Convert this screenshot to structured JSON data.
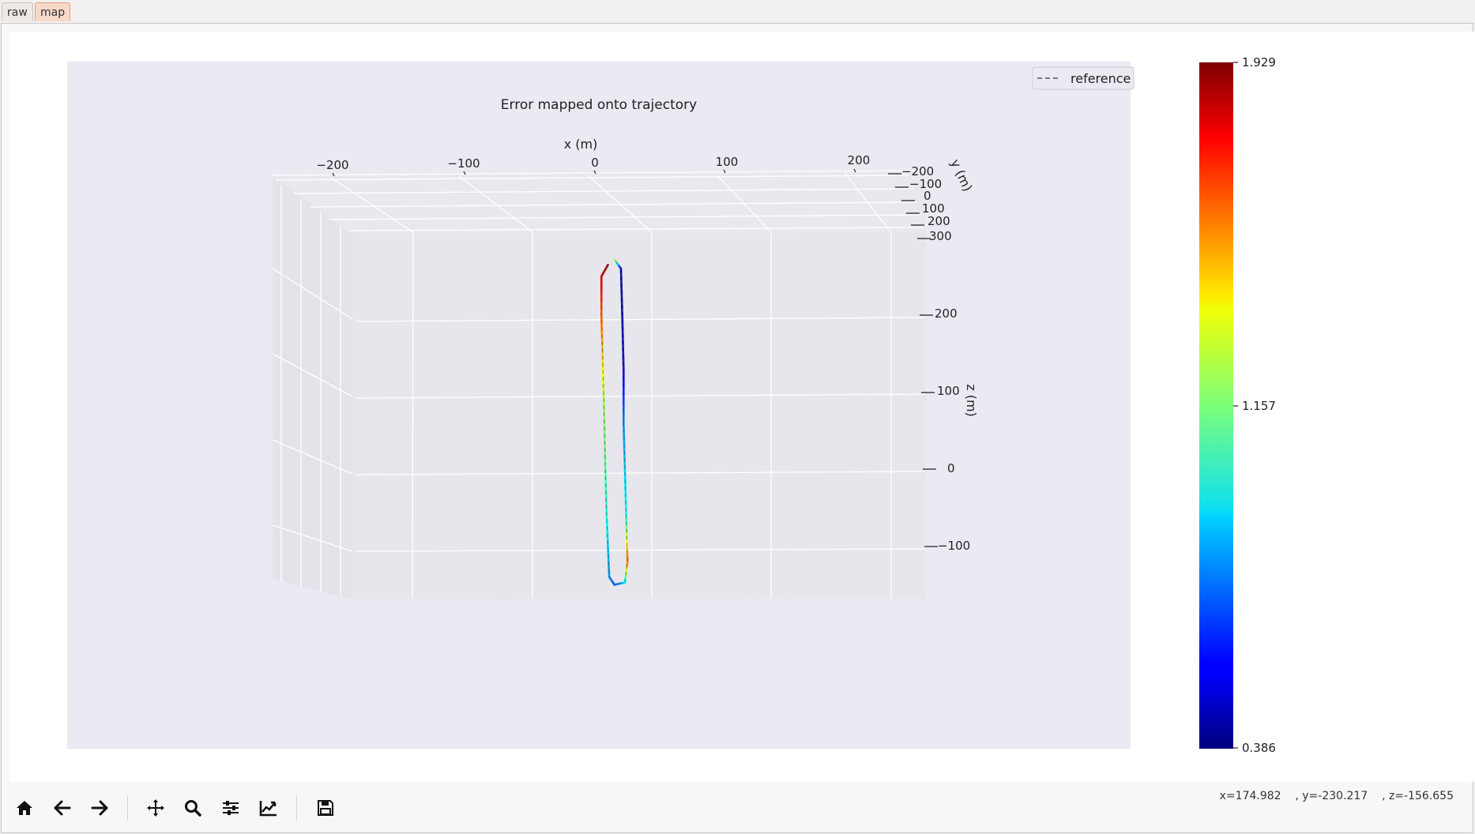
{
  "tabs": [
    {
      "label": "raw",
      "active": false
    },
    {
      "label": "map",
      "active": true
    }
  ],
  "plot": {
    "title": "Error mapped onto trajectory",
    "legend": {
      "label": "reference",
      "placement": "top-right",
      "line_style": "dashed"
    },
    "x_label": "x (m)",
    "y_label": "y (m)",
    "z_label": "z (m)",
    "x_ticks": [
      "−200",
      "−100",
      "0",
      "100",
      "200"
    ],
    "y_ticks": [
      "−200",
      "−100",
      "0",
      "100",
      "200",
      "300"
    ],
    "z_ticks": [
      "200",
      "100",
      "0",
      "−100"
    ],
    "colormap": "jet",
    "colorbar_ticks": [
      "1.929",
      "1.157",
      "0.386"
    ],
    "colorbar_range": [
      0.386,
      1.929
    ],
    "background_color": "#eaeaf2",
    "pane_color": "#e6e6ec"
  },
  "chart_data": {
    "type": "line",
    "title": "Error mapped onto trajectory",
    "xlabel": "x (m)",
    "ylabel": "y (m)",
    "zlabel": "z (m)",
    "projection": "3d",
    "colormap": "jet",
    "color_range": [
      0.386,
      1.929
    ],
    "series": [
      {
        "name": "reference",
        "style": "dashed",
        "points": [
          {
            "x": 10,
            "z": 265,
            "e": 1.9
          },
          {
            "x": 5,
            "z": 250,
            "e": 1.8
          },
          {
            "x": 5,
            "z": 200,
            "e": 1.6
          },
          {
            "x": 6,
            "z": 140,
            "e": 1.4
          },
          {
            "x": 7,
            "z": 80,
            "e": 1.2
          },
          {
            "x": 8,
            "z": 0,
            "e": 1.1
          },
          {
            "x": 9,
            "z": -60,
            "e": 1.0
          },
          {
            "x": 10,
            "z": -100,
            "e": 0.9
          },
          {
            "x": 11,
            "z": -140,
            "e": 0.8
          },
          {
            "x": 15,
            "z": -150,
            "e": 0.7
          },
          {
            "x": 23,
            "z": -147,
            "e": 0.9
          },
          {
            "x": 25,
            "z": -120,
            "e": 1.6
          },
          {
            "x": 24,
            "z": -60,
            "e": 1.0
          },
          {
            "x": 23,
            "z": 0,
            "e": 0.9
          },
          {
            "x": 22,
            "z": 60,
            "e": 0.8
          },
          {
            "x": 22,
            "z": 130,
            "e": 0.5
          },
          {
            "x": 21,
            "z": 200,
            "e": 0.45
          },
          {
            "x": 20,
            "z": 260,
            "e": 0.4
          },
          {
            "x": 15,
            "z": 272,
            "e": 1.3
          }
        ]
      }
    ],
    "grid": true,
    "legend_placement": "top-right"
  },
  "toolbar": {
    "buttons": [
      "home-icon",
      "back-icon",
      "forward-icon",
      "pan-icon",
      "zoom-icon",
      "configure-subplots-icon",
      "edit-axes-icon",
      "save-icon"
    ]
  },
  "status": {
    "x": "x=174.982",
    "y": ", y=-230.217",
    "z": ", z=-156.655"
  }
}
